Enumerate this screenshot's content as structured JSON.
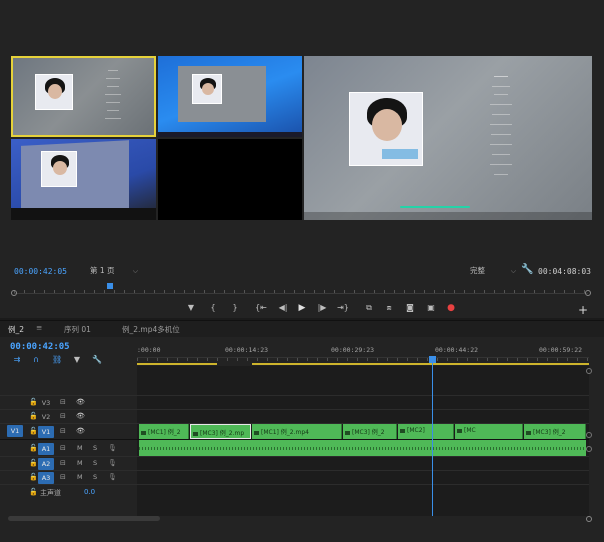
{
  "monitor": {
    "timecode": "00:00:42:05",
    "duration": "00:04:08:03",
    "page_label": "第 1 页",
    "quality_label": "完整"
  },
  "timeline": {
    "tabs": [
      {
        "label": "例_2"
      },
      {
        "label": "序列 01"
      },
      {
        "label": "例_2.mp4多机位"
      }
    ],
    "timecode": "00:00:42:05",
    "ruler": [
      ":00:00",
      "00:00:14:23",
      "00:00:29:23",
      "00:00:44:22",
      "00:00:59:22"
    ],
    "tracks": [
      {
        "name": "V3"
      },
      {
        "name": "V2"
      },
      {
        "name": "V1"
      },
      {
        "name": "A1"
      },
      {
        "name": "A2"
      },
      {
        "name": "A3"
      }
    ],
    "v1_source": "V1",
    "master_label": "主声道",
    "master_value": "0.0",
    "clips": [
      {
        "label": "[MC1] 例_2"
      },
      {
        "label": "[MC3] 例_2.mp"
      },
      {
        "label": "[MC1] 例_2.mp4"
      },
      {
        "label": "[MC3] 例_2"
      },
      {
        "label": "[MC2]"
      },
      {
        "label": "[MC"
      },
      {
        "label": "[MC3] 例_2"
      }
    ]
  }
}
